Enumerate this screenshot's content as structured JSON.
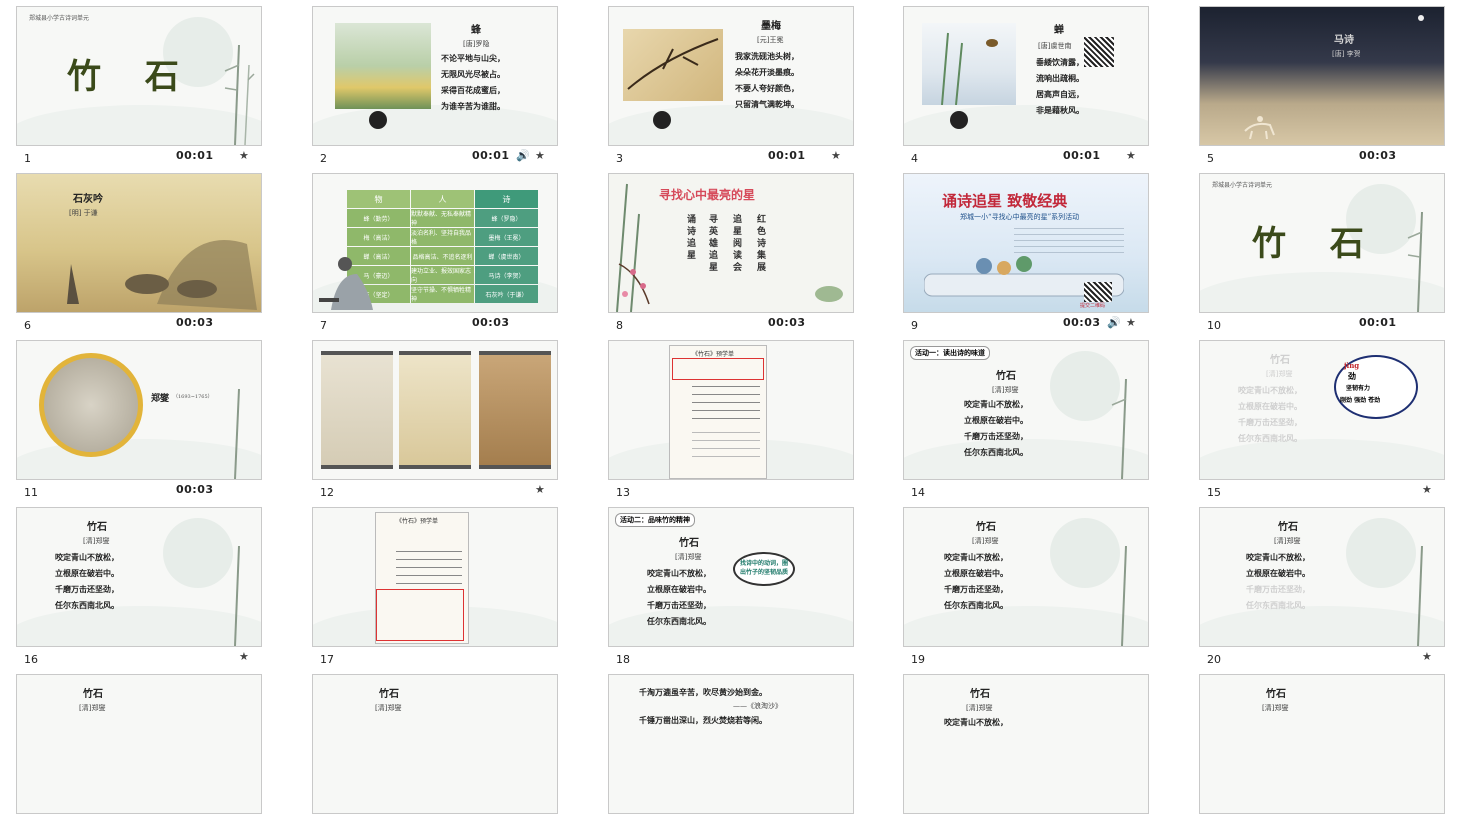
{
  "slides": [
    {
      "num": "1",
      "time": "00:01",
      "header": "郑城县小学古诗词单元",
      "title": "竹 石"
    },
    {
      "num": "2",
      "time": "00:01",
      "poem": {
        "title": "蜂",
        "author": "[唐]罗隐",
        "lines": [
          "不论平地与山尖，",
          "无限风光尽被占。",
          "采得百花成蜜后，",
          "为谁辛苦为谁甜。"
        ]
      }
    },
    {
      "num": "3",
      "time": "00:01",
      "poem": {
        "title": "墨梅",
        "author": "[元]王冕",
        "lines": [
          "我家洗砚池头树，",
          "朵朵花开淡墨痕。",
          "不要人夸好颜色，",
          "只留清气满乾坤。"
        ]
      }
    },
    {
      "num": "4",
      "time": "00:01",
      "poem": {
        "title": "蝉",
        "author": "[唐]虞世南",
        "lines": [
          "垂緌饮清露，",
          "流响出疏桐。",
          "居高声自远，",
          "非是藉秋风。"
        ]
      }
    },
    {
      "num": "5",
      "time": "00:03",
      "poem": {
        "title": "马诗",
        "author": "[唐] 李贺"
      }
    },
    {
      "num": "6",
      "time": "00:03",
      "poem": {
        "title": "石灰吟",
        "author": "[明] 于谦"
      }
    },
    {
      "num": "7",
      "time": "00:03",
      "table": {
        "headers": [
          "物",
          "人",
          "诗"
        ],
        "rows": [
          [
            "蜂（勤劳）",
            "默默奉献、无私奉献精神",
            "蜂（罗隐）"
          ],
          [
            "梅（高洁）",
            "淡泊名利、坚持自我品格",
            "墨梅（王冕）"
          ],
          [
            "蝉（高洁）",
            "品格高洁、不追名逐利",
            "蝉（虞世南）"
          ],
          [
            "马（豪迈）",
            "建功立业、报效国家志向",
            "马诗（李贺）"
          ],
          [
            "石（坚定）",
            "坚守节操、不惧牺牲精神",
            "石灰吟（于谦）"
          ]
        ]
      }
    },
    {
      "num": "8",
      "time": "00:03",
      "title": "寻找心中最亮的星",
      "columns": [
        "诵诗追星",
        "寻英雄追星",
        "追星阅读会",
        "红色诗集展"
      ]
    },
    {
      "num": "9",
      "time": "00:03",
      "title": "诵诗追星  致敬经典",
      "subtitle": "郑城一小“寻找心中最亮的星”系列活动",
      "footer": "提交二维码"
    },
    {
      "num": "10",
      "time": "00:01",
      "header": "郑城县小学古诗词单元",
      "title": "竹 石"
    },
    {
      "num": "11",
      "time": "00:03",
      "name": "郑燮",
      "years": "（1693~1765）"
    },
    {
      "num": "12",
      "time": ""
    },
    {
      "num": "13",
      "time": "",
      "sheet_title": "《竹石》预学单"
    },
    {
      "num": "14",
      "time": "",
      "tag": "活动一：读出诗的味道",
      "poem": {
        "title": "竹石",
        "author": "[清]郑燮",
        "lines": [
          "咬定青山不放松，",
          "立根原在破岩中。",
          "千磨万击还坚劲，",
          "任尔东西南北风。"
        ]
      }
    },
    {
      "num": "15",
      "time": "",
      "poem": {
        "title": "竹石",
        "author": "[清]郑燮",
        "lines": [
          "咬定青山不放松，",
          "立根原在破岩中。",
          "千磨万击还坚劲，",
          "任尔东西南北风。"
        ]
      },
      "bubble": {
        "pinyin": "jìng",
        "char": "劲",
        "meaning": "坚韧有力",
        "words": "刚劲 强劲 苍劲"
      }
    },
    {
      "num": "16",
      "time": "",
      "poem": {
        "title": "竹石",
        "author": "[清]郑燮",
        "lines": [
          "咬定青山不放松，",
          "立根原在破岩中。",
          "千磨万击还坚劲，",
          "任尔东西南北风。"
        ]
      }
    },
    {
      "num": "17",
      "time": "",
      "sheet_title": "《竹石》预学单"
    },
    {
      "num": "18",
      "time": "",
      "tag": "活动二：品味竹的精神",
      "poem": {
        "title": "竹石",
        "author": "[清]郑燮",
        "lines": [
          "咬定青山不放松，",
          "立根原在破岩中。",
          "千磨万击还坚劲，",
          "任尔东西南北风。"
        ]
      },
      "bubble_text": "找诗中的动词，圈出竹子的坚韧品质"
    },
    {
      "num": "19",
      "time": "",
      "poem": {
        "title": "竹石",
        "author": "[清]郑燮",
        "lines": [
          "咬定青山不放松，",
          "立根原在破岩中。",
          "千磨万击还坚劲，",
          "任尔东西南北风。"
        ]
      }
    },
    {
      "num": "20",
      "time": "",
      "poem": {
        "title": "竹石",
        "author": "[清]郑燮",
        "lines": [
          "咬定青山不放松，",
          "立根原在破岩中。",
          "千磨万击还坚劲，",
          "任尔东西南北风。"
        ]
      }
    },
    {
      "num": "21",
      "poem": {
        "title": "竹石",
        "author": "[清]郑燮"
      }
    },
    {
      "num": "22",
      "poem": {
        "title": "竹石",
        "author": "[清]郑燮"
      }
    },
    {
      "num": "23",
      "lines": [
        "千淘万漉虽辛苦，吹尽黄沙始到金。",
        "——《浪淘沙》",
        "千锤万凿出深山，烈火焚烧若等闲。"
      ]
    },
    {
      "num": "24",
      "poem": {
        "title": "竹石",
        "author": "[清]郑燮",
        "lines": [
          "咬定青山不放松，"
        ]
      }
    },
    {
      "num": "25",
      "poem": {
        "title": "竹石",
        "author": "[清]郑燮"
      }
    }
  ],
  "icons": {
    "star": "★",
    "speaker": "🔊"
  }
}
